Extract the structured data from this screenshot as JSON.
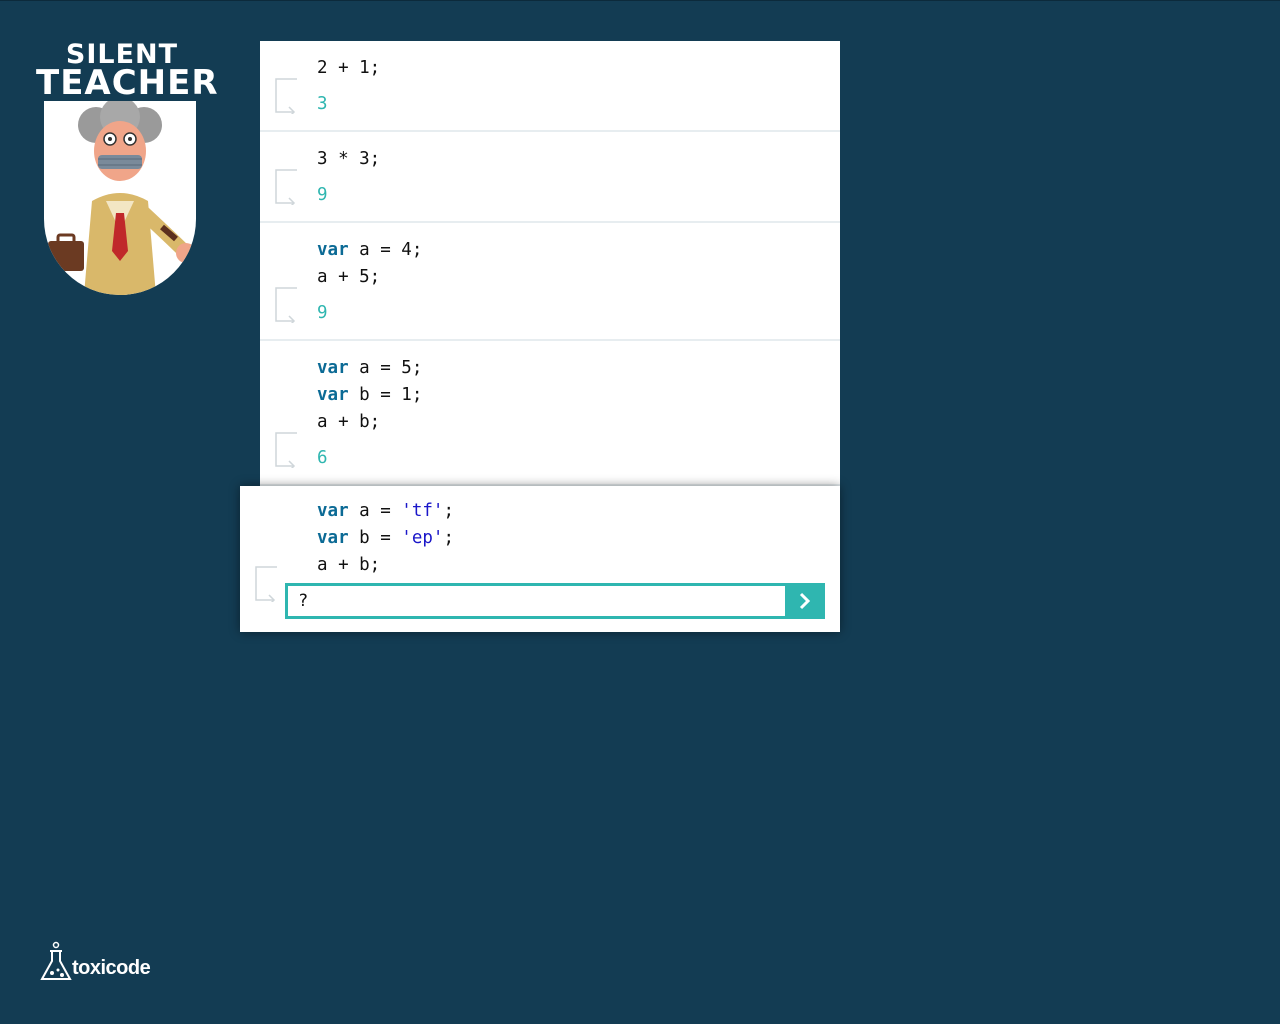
{
  "logo": {
    "line1": "SILENT",
    "line2": "TEACHER"
  },
  "exercises": [
    {
      "code": [
        "2 + 1;"
      ],
      "result": "3"
    },
    {
      "code": [
        "3 * 3;"
      ],
      "result": "9"
    },
    {
      "code": [
        "var a = 4;",
        "a + 5;"
      ],
      "result": "9"
    },
    {
      "code": [
        "var a = 5;",
        "var b = 1;",
        "a + b;"
      ],
      "result": "6"
    }
  ],
  "current": {
    "line1": {
      "kw": "var",
      "rest1": " a = ",
      "str": "'tf'",
      "rest2": ";"
    },
    "line2": {
      "kw": "var",
      "rest1": " b = ",
      "str": "'ep'",
      "rest2": ";"
    },
    "line3": "a + b;",
    "answer_value": "?"
  },
  "footer": {
    "brand": "toxicode"
  },
  "colors": {
    "background": "#133c53",
    "accent": "#2fb6b0",
    "keyword": "#0b6a95",
    "string": "#1b17c9"
  },
  "icons": {
    "submit": "chevron-right-icon",
    "result_marker": "return-arrow-icon"
  }
}
